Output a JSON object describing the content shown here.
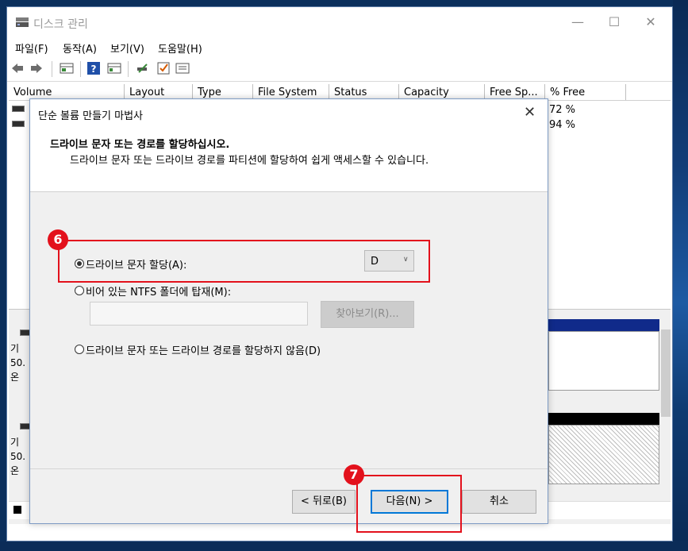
{
  "main_window": {
    "title": "디스크 관리",
    "controls": {
      "minimize": "—",
      "maximize": "☐",
      "close": "✕"
    },
    "menu": [
      "파일(F)",
      "동작(A)",
      "보기(V)",
      "도움말(H)"
    ],
    "toolbar_icons": [
      "back-arrow-icon",
      "forward-arrow-icon",
      "grid-icon",
      "help-icon",
      "properties-icon",
      "connect-icon",
      "checklist-icon",
      "list-icon"
    ]
  },
  "volume_table": {
    "columns": [
      "Volume",
      "Layout",
      "Type",
      "File System",
      "Status",
      "Capacity",
      "Free Sp...",
      "% Free"
    ],
    "rows": [
      {
        "pct_free": "72 %"
      },
      {
        "pct_free": "94 %"
      }
    ]
  },
  "disks": [
    {
      "lines": [
        "기",
        "50.",
        "온"
      ]
    },
    {
      "lines": [
        "기",
        "50.",
        "온"
      ]
    }
  ],
  "wizard": {
    "title": "단순 볼륨 만들기 마법사",
    "close": "✕",
    "heading": "드라이브 문자 또는 경로를 할당하십시오.",
    "subheading": "드라이브 문자 또는 드라이브 경로를 파티션에 할당하여 쉽게 액세스할 수 있습니다.",
    "options": {
      "assign_letter": "드라이브 문자 할당(A):",
      "mount_folder": "비어 있는 NTFS 폴더에 탑재(M):",
      "no_assign": "드라이브 문자 또는 드라이브 경로를 할당하지 않음(D)"
    },
    "selected_option": "assign_letter",
    "drive_letter": "D",
    "browse_label": "찾아보기(R)...",
    "buttons": {
      "back": "< 뒤로(B)",
      "next": "다음(N) >",
      "cancel": "취소"
    }
  },
  "annotations": {
    "marker_1": "6",
    "marker_2": "7",
    "color": "#e3111c"
  }
}
